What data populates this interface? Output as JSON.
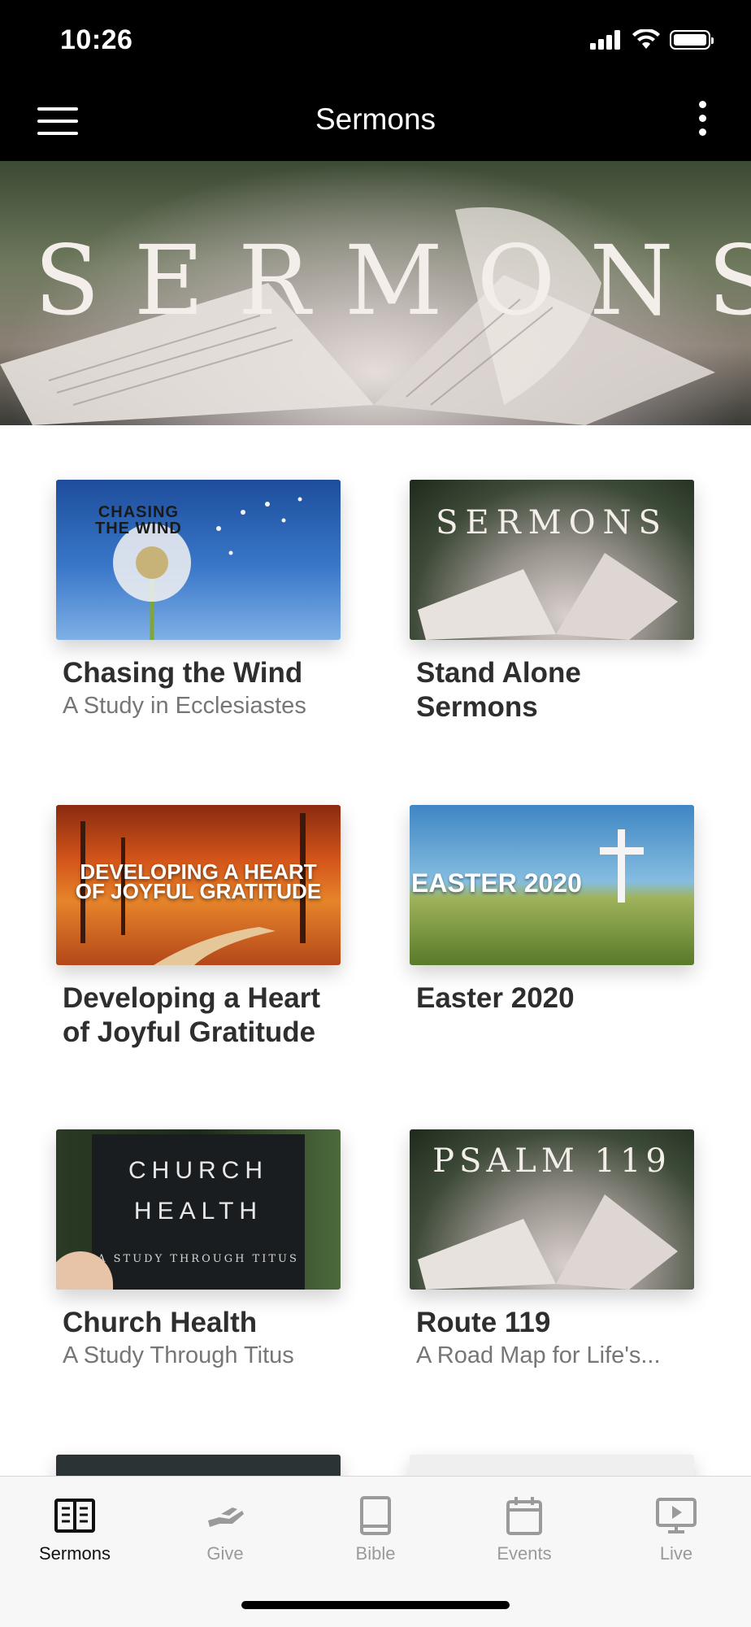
{
  "status_bar": {
    "time": "10:26"
  },
  "nav": {
    "title": "Sermons"
  },
  "hero": {
    "title": "SERMONS"
  },
  "cards": [
    {
      "title": "Chasing the Wind",
      "subtitle": "A Study in Ecclesiastes",
      "thumb_text": [
        "CHASING",
        "THE WIND"
      ]
    },
    {
      "title": "Stand Alone Sermons",
      "subtitle": "",
      "thumb_text": "SERMONS"
    },
    {
      "title": "Developing a Heart of Joyful Gratitude",
      "subtitle": "",
      "thumb_text": [
        "DEVELOPING A HEART",
        "OF JOYFUL GRATITUDE"
      ]
    },
    {
      "title": "Easter 2020",
      "subtitle": "",
      "thumb_text": "EASTER 2020"
    },
    {
      "title": "Church Health",
      "subtitle": "A Study Through Titus",
      "thumb_text": [
        "CHURCH",
        "HEALTH",
        "A STUDY THROUGH TITUS"
      ]
    },
    {
      "title": "Route 119",
      "subtitle": "A Road Map for Life's...",
      "thumb_text": "PSALM 119"
    }
  ],
  "tabs": [
    {
      "label": "Sermons",
      "icon": "book-open-icon",
      "active": true
    },
    {
      "label": "Give",
      "icon": "hand-give-icon",
      "active": false
    },
    {
      "label": "Bible",
      "icon": "bible-icon",
      "active": false
    },
    {
      "label": "Events",
      "icon": "calendar-icon",
      "active": false
    },
    {
      "label": "Live",
      "icon": "live-video-icon",
      "active": false
    }
  ],
  "colors": {
    "bar_background": "#000000",
    "tab_active": "#111111",
    "tab_inactive": "#9a9a9a"
  }
}
